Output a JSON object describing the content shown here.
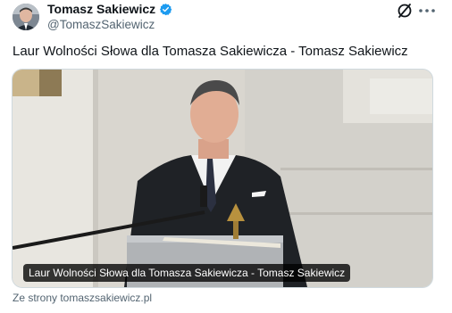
{
  "tweet": {
    "author_name": "Tomasz Sakiewicz",
    "author_handle": "@TomaszSakiewicz",
    "text": "Laur Wolności Słowa dla Tomasza Sakiewicza - Tomasz Sakiewicz"
  },
  "card": {
    "caption": "Laur Wolności Słowa dla Tomasza Sakiewicza - Tomasz Sakiewicz",
    "source": "Ze strony tomaszsakiewicz.pl"
  },
  "colors": {
    "verified": "#1d9bf0",
    "secondary_text": "#536471"
  },
  "icons": {
    "verified": "verified-badge-icon",
    "grok": "grok-icon",
    "more": "more-options-icon"
  }
}
